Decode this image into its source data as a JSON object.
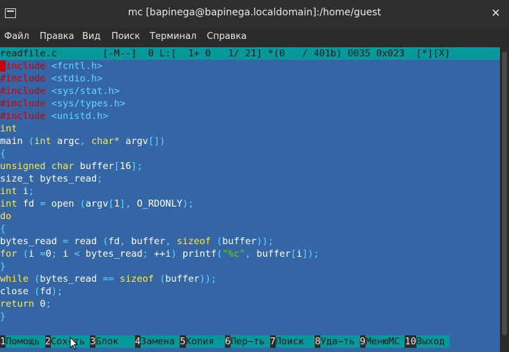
{
  "window": {
    "title": "mc [bapinega@bapinega.localdomain]:/home/guest"
  },
  "menu": [
    "Файл",
    "Правка",
    "Вид",
    "Поиск",
    "Терминал",
    "Справка"
  ],
  "status_line": "readfile.c        [-M--]  0 L:[  1+ 0   1/ 21] *(0   / 401b) 0035 0x023  [*][X]",
  "code": [
    [
      [
        "pre",
        "#include "
      ],
      [
        "pu",
        "<fcntl.h>"
      ]
    ],
    [
      [
        "pre",
        "#include "
      ],
      [
        "pu",
        "<stdio.h>"
      ]
    ],
    [
      [
        "pre",
        "#include "
      ],
      [
        "pu",
        "<sys/stat.h>"
      ]
    ],
    [
      [
        "pre",
        "#include "
      ],
      [
        "pu",
        "<sys/types.h>"
      ]
    ],
    [
      [
        "pre",
        "#include "
      ],
      [
        "pu",
        "<unistd.h>"
      ]
    ],
    [
      [
        "ty",
        "int"
      ]
    ],
    [
      [
        "tx",
        "main "
      ],
      [
        "pu",
        "("
      ],
      [
        "ty",
        "int"
      ],
      [
        "tx",
        " argc"
      ],
      [
        "pu",
        ", "
      ],
      [
        "ty",
        "char*"
      ],
      [
        "tx",
        " argv"
      ],
      [
        "pu",
        "[])"
      ]
    ],
    [
      [
        "pu",
        "{"
      ]
    ],
    [
      [
        "ty",
        "unsigned char"
      ],
      [
        "tx",
        " buffer"
      ],
      [
        "pu",
        "["
      ],
      [
        "tx",
        "16"
      ],
      [
        "pu",
        "];"
      ]
    ],
    [
      [
        "tx",
        "size_t bytes_read"
      ],
      [
        "pu",
        ";"
      ]
    ],
    [
      [
        "ty",
        "int"
      ],
      [
        "tx",
        " i"
      ],
      [
        "pu",
        ";"
      ]
    ],
    [
      [
        "ty",
        "int"
      ],
      [
        "tx",
        " fd "
      ],
      [
        "pu",
        "="
      ],
      [
        "tx",
        " open "
      ],
      [
        "pu",
        "("
      ],
      [
        "tx",
        "argv"
      ],
      [
        "pu",
        "["
      ],
      [
        "tx",
        "1"
      ],
      [
        "pu",
        "], "
      ],
      [
        "tx",
        "O_RDONLY"
      ],
      [
        "pu",
        ");"
      ]
    ],
    [
      [
        "kw",
        "do"
      ]
    ],
    [
      [
        "pu",
        "{"
      ]
    ],
    [
      [
        "tx",
        "bytes_read "
      ],
      [
        "pu",
        "="
      ],
      [
        "tx",
        " read "
      ],
      [
        "pu",
        "("
      ],
      [
        "tx",
        "fd"
      ],
      [
        "pu",
        ", "
      ],
      [
        "tx",
        "buffer"
      ],
      [
        "pu",
        ", "
      ],
      [
        "kw",
        "sizeof"
      ],
      [
        "tx",
        " "
      ],
      [
        "pu",
        "("
      ],
      [
        "tx",
        "buffer"
      ],
      [
        "pu",
        "));"
      ]
    ],
    [
      [
        "kw",
        "for"
      ],
      [
        "tx",
        " "
      ],
      [
        "pu",
        "("
      ],
      [
        "tx",
        "i "
      ],
      [
        "pu",
        "="
      ],
      [
        "tx",
        "0"
      ],
      [
        "pu",
        "; "
      ],
      [
        "tx",
        "i "
      ],
      [
        "pu",
        "<"
      ],
      [
        "tx",
        " bytes_read"
      ],
      [
        "pu",
        "; "
      ],
      [
        "tx",
        "++i"
      ],
      [
        "pu",
        ")"
      ],
      [
        "tx",
        " printf"
      ],
      [
        "pu",
        "("
      ],
      [
        "st",
        "\"%c\""
      ],
      [
        "pu",
        ", "
      ],
      [
        "tx",
        "buffer"
      ],
      [
        "pu",
        "["
      ],
      [
        "tx",
        "i"
      ],
      [
        "pu",
        "]);"
      ]
    ],
    [
      [
        "pu",
        "}"
      ]
    ],
    [
      [
        "kw",
        "while"
      ],
      [
        "tx",
        " "
      ],
      [
        "pu",
        "("
      ],
      [
        "tx",
        "bytes_read "
      ],
      [
        "pu",
        "=="
      ],
      [
        "tx",
        " "
      ],
      [
        "kw",
        "sizeof"
      ],
      [
        "tx",
        " "
      ],
      [
        "pu",
        "("
      ],
      [
        "tx",
        "buffer"
      ],
      [
        "pu",
        "));"
      ]
    ],
    [
      [
        "tx",
        "close "
      ],
      [
        "pu",
        "("
      ],
      [
        "tx",
        "fd"
      ],
      [
        "pu",
        ");"
      ]
    ],
    [
      [
        "kw",
        "return"
      ],
      [
        "tx",
        " 0"
      ],
      [
        "pu",
        ";"
      ]
    ],
    [
      [
        "pu",
        "}"
      ]
    ]
  ],
  "fkeys": [
    {
      "num": "1",
      "label": "Помощь"
    },
    {
      "num": "2",
      "label": "Сох~ть"
    },
    {
      "num": "3",
      "label": "Блок"
    },
    {
      "num": "4",
      "label": "Замена"
    },
    {
      "num": "5",
      "label": "Копия"
    },
    {
      "num": "6",
      "label": "Пер~ть"
    },
    {
      "num": "7",
      "label": "Поиск"
    },
    {
      "num": "8",
      "label": "Уда~ть"
    },
    {
      "num": "9",
      "label": "МенюMC"
    },
    {
      "num": "10",
      "label": "Выход"
    }
  ],
  "colors": {
    "editor_bg": "#3465a4",
    "status_bg": "#06989a",
    "preprocessor": "#cc0000",
    "keyword": "#fce94f",
    "punctuation": "#5fd7ff",
    "string": "#5fd700"
  }
}
